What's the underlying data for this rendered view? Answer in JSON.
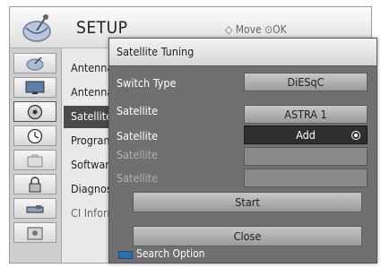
{
  "setup": {
    "title": "SETUP",
    "hint": "◇ Move   ⊙OK",
    "menu": [
      {
        "label": "Antenna",
        "icon": "satellite-dish-icon"
      },
      {
        "label": "Antenna",
        "icon": "tv-icon"
      },
      {
        "label": "Satellite",
        "icon": "disc-icon",
        "selected": true
      },
      {
        "label": "Program",
        "icon": "clock-icon"
      },
      {
        "label": "Software",
        "icon": "briefcase-icon"
      },
      {
        "label": "Diagnos",
        "icon": "lock-icon"
      },
      {
        "label": "CI Inform",
        "icon": "card-slot-icon"
      }
    ],
    "extra_icon": "settings-card-icon"
  },
  "dialog": {
    "title": "Satellite Tuning",
    "switch_type": {
      "label": "Switch Type",
      "value": "DiESqC"
    },
    "satellite_1": {
      "label": "Satellite",
      "value": "ASTRA 1"
    },
    "satellite_2": {
      "label": "Satellite",
      "value": "Add"
    },
    "satellite_3": {
      "label": "Satellite",
      "value": ""
    },
    "satellite_4": {
      "label": "Satellite",
      "value": ""
    },
    "start_label": "Start",
    "close_label": "Close",
    "search_option": "Search Option"
  },
  "colors": {
    "blue_key": "#2d6fb0",
    "focus": "#2f2f2f"
  }
}
